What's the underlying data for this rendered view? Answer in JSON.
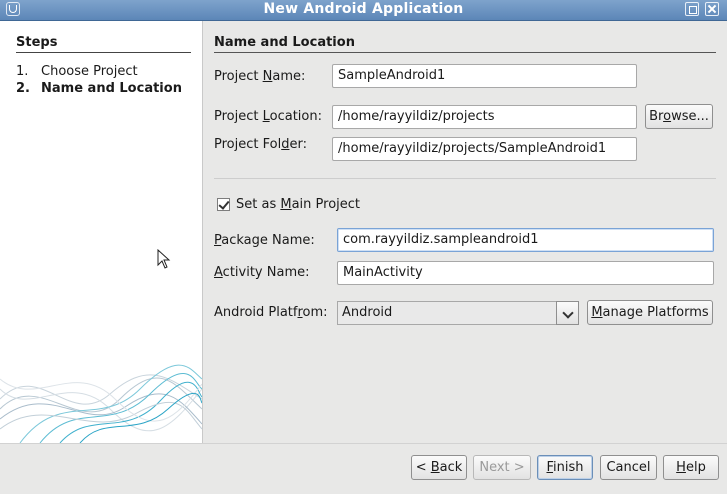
{
  "window": {
    "title": "New Android Application"
  },
  "steps": {
    "heading": "Steps",
    "items": [
      {
        "num": "1.",
        "label": "Choose Project"
      },
      {
        "num": "2.",
        "label": "Name and Location"
      }
    ]
  },
  "section_title": "Name and Location",
  "form": {
    "project_name": {
      "label_pre": "Project ",
      "label_ul": "N",
      "label_post": "ame:",
      "value": "SampleAndroid1"
    },
    "project_location": {
      "label_pre": "Project ",
      "label_ul": "L",
      "label_post": "ocation:",
      "value": "/home/rayyildiz/projects"
    },
    "browse_button": {
      "pre": "Br",
      "ul": "o",
      "post": "wse..."
    },
    "project_folder": {
      "label_pre": "Project Fol",
      "label_ul": "d",
      "label_post": "er:",
      "value": "/home/rayyildiz/projects/SampleAndroid1"
    },
    "main_project": {
      "label_pre": "Set as ",
      "label_ul": "M",
      "label_post": "ain Project",
      "checked": true
    },
    "package_name": {
      "label_pre": "",
      "label_ul": "P",
      "label_post": "ackage Name:",
      "value": "com.rayyildiz.sampleandroid1"
    },
    "activity_name": {
      "label_pre": "",
      "label_ul": "A",
      "label_post": "ctivity Name:",
      "value": "MainActivity"
    },
    "platform": {
      "label_pre": "Android Platf",
      "label_ul": "r",
      "label_post": "om:",
      "value": "Android"
    },
    "manage_platforms": {
      "pre": "",
      "ul": "M",
      "post": "anage Platforms"
    }
  },
  "buttons": {
    "back": {
      "pre": "< ",
      "ul": "B",
      "post": "ack"
    },
    "next": {
      "pre": "Next >",
      "ul": "",
      "post": ""
    },
    "finish": {
      "pre": "",
      "ul": "F",
      "post": "inish"
    },
    "cancel": {
      "pre": "Cancel",
      "ul": "",
      "post": ""
    },
    "help": {
      "pre": "",
      "ul": "H",
      "post": "elp"
    }
  }
}
